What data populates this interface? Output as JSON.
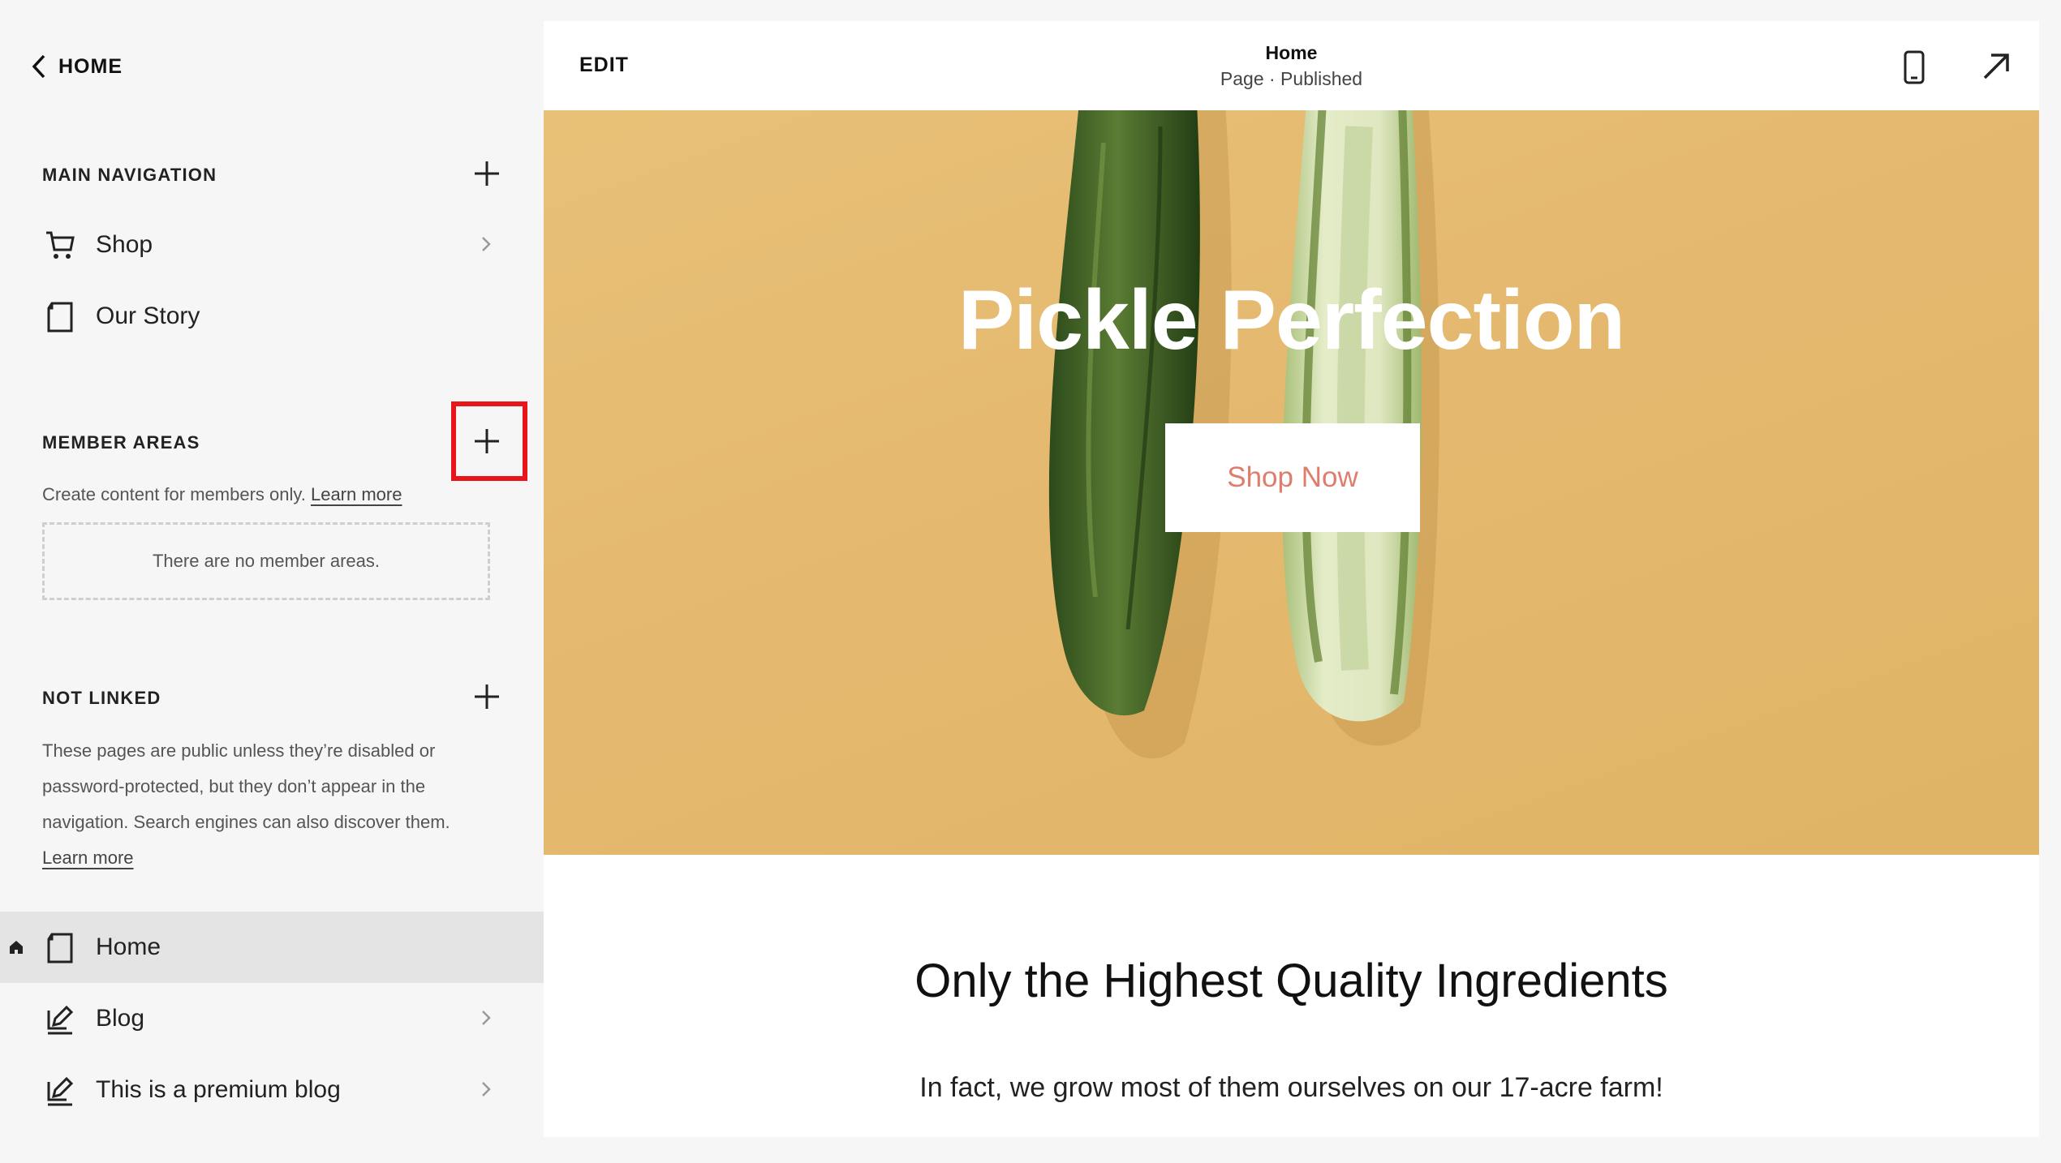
{
  "sidebar": {
    "back_label": "HOME",
    "main_navigation": {
      "title": "MAIN NAVIGATION",
      "items": [
        {
          "label": "Shop",
          "icon": "cart-icon",
          "has_chevron": true
        },
        {
          "label": "Our Story",
          "icon": "page-icon",
          "has_chevron": false
        }
      ]
    },
    "member_areas": {
      "title": "MEMBER AREAS",
      "description": "Create content for members only.",
      "learn_more": "Learn more",
      "empty_text": "There are no member areas."
    },
    "not_linked": {
      "title": "NOT LINKED",
      "description_lines": [
        "These pages are public unless they’re disabled or",
        "password-protected, but they don’t appear in the",
        "navigation. Search engines can also discover them."
      ],
      "learn_more": "Learn more",
      "items": [
        {
          "label": "Home",
          "icon": "page-icon",
          "active": true,
          "is_homepage": true
        },
        {
          "label": "Blog",
          "icon": "blog-icon",
          "has_chevron": true
        },
        {
          "label": "This is a premium blog",
          "icon": "blog-icon",
          "has_chevron": true
        }
      ]
    }
  },
  "preview": {
    "edit_label": "EDIT",
    "page_title": "Home",
    "page_status": "Page · Published",
    "hero_title": "Pickle Perfection",
    "hero_button": "Shop Now",
    "section_heading": "Only the Highest Quality Ingredients",
    "section_text": "In fact, we grow most of them ourselves on our 17-acre farm!"
  },
  "colors": {
    "highlight_border": "#e8161b",
    "hero_background": "#e4b86e",
    "button_text": "#e07c6c",
    "active_row": "#e4e4e4"
  }
}
